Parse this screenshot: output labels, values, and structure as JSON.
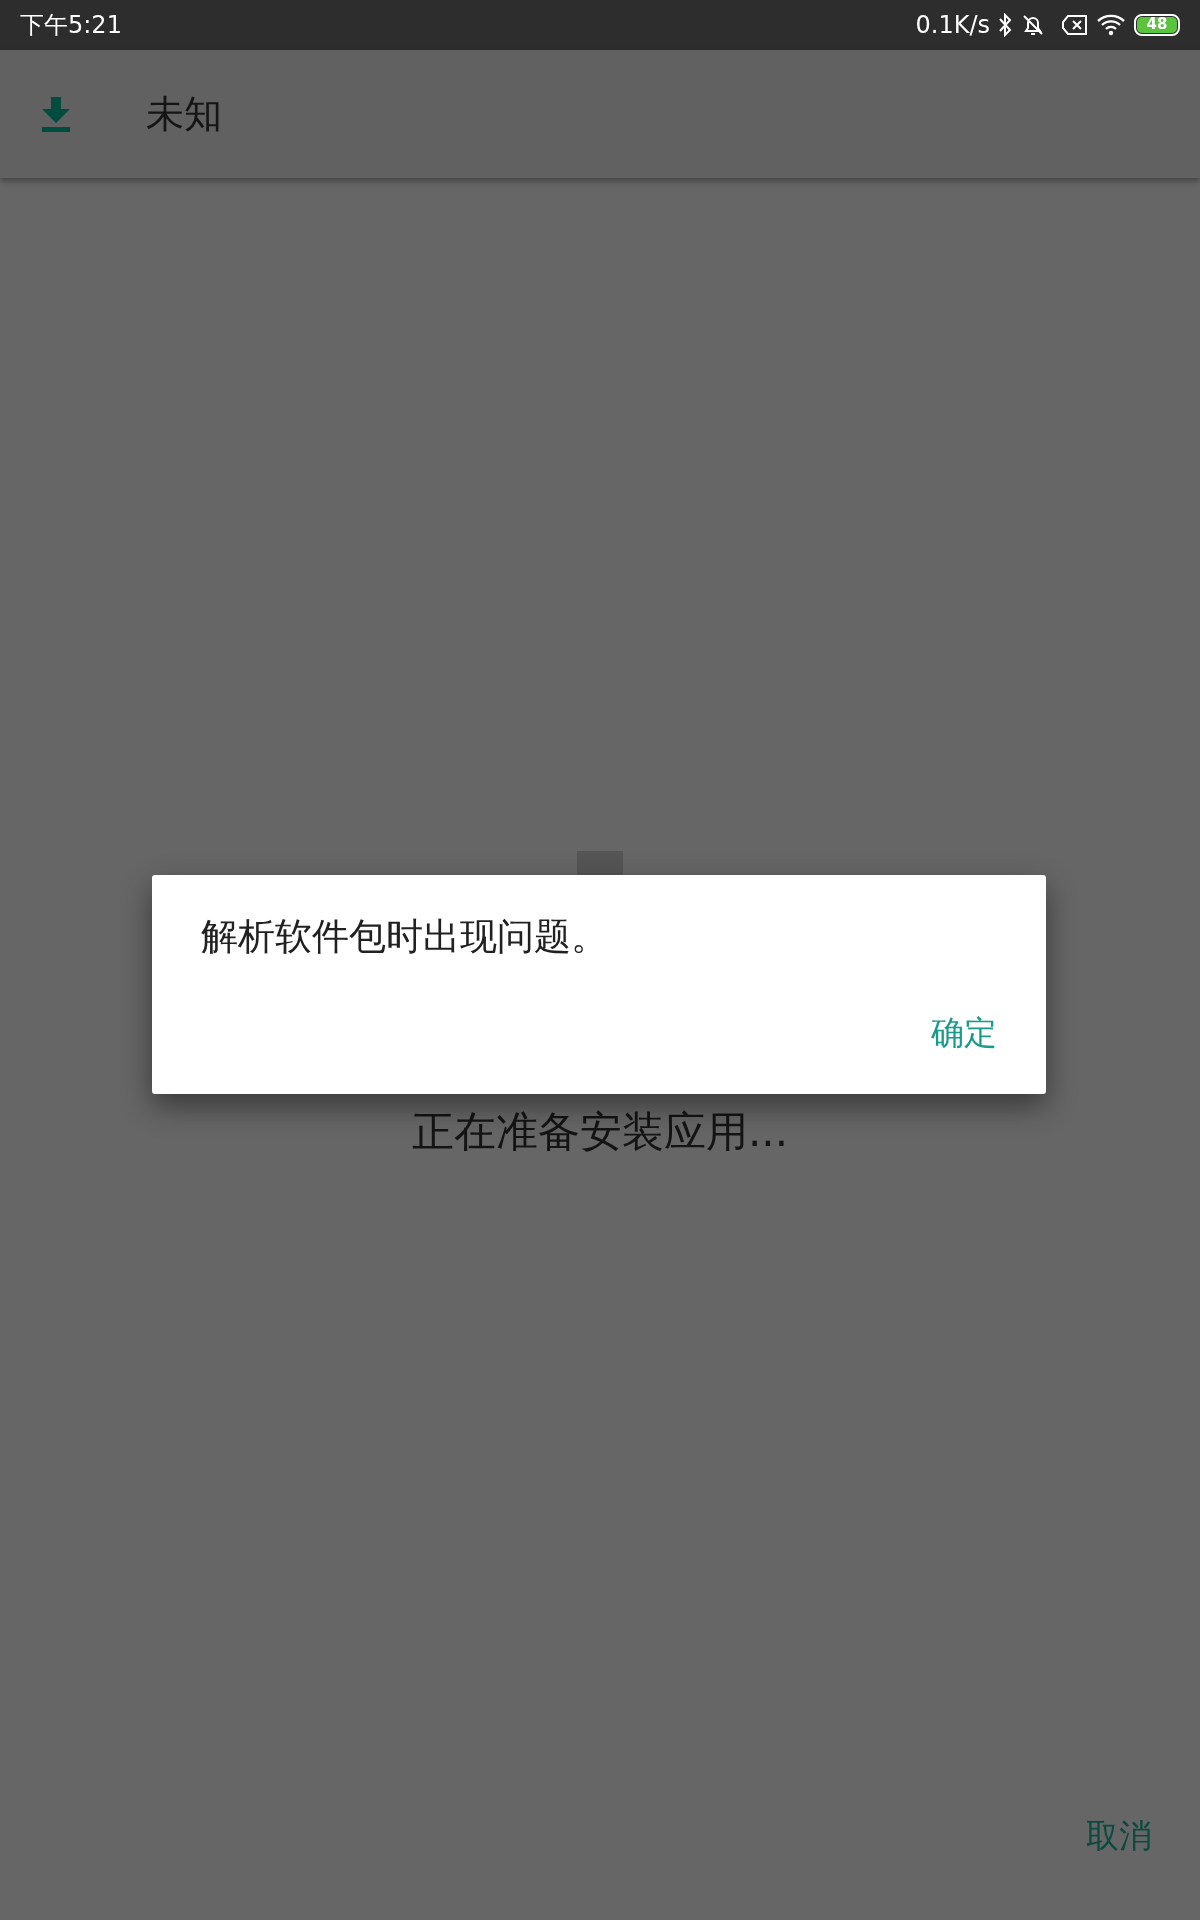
{
  "status_bar": {
    "time": "下午5:21",
    "network_speed": "0.1K/s",
    "battery": "48"
  },
  "app_bar": {
    "title": "未知"
  },
  "progress_text": "正在准备安装应用...",
  "dialog": {
    "message": "解析软件包时出现问题。",
    "buttons": [
      "确定"
    ]
  },
  "cancel_button": "取消"
}
